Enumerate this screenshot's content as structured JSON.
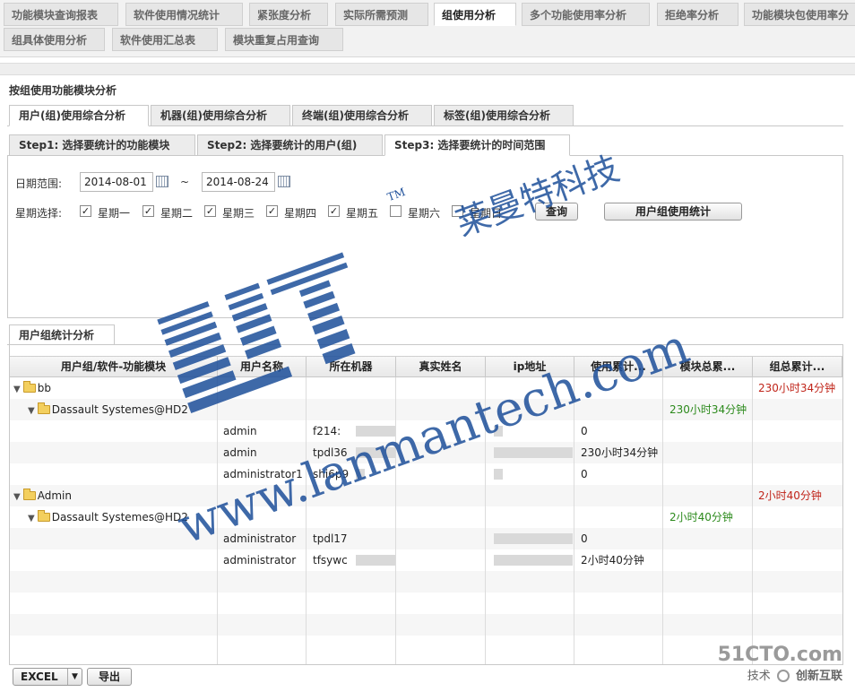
{
  "top_tabs": [
    {
      "label": "功能模块查询报表",
      "active": false
    },
    {
      "label": "软件使用情况统计",
      "active": false
    },
    {
      "label": "紧张度分析",
      "active": false
    },
    {
      "label": "实际所需预测",
      "active": false
    },
    {
      "label": "组使用分析",
      "active": true
    },
    {
      "label": "多个功能使用率分析",
      "active": false
    },
    {
      "label": "拒绝率分析",
      "active": false
    },
    {
      "label": "功能模块包使用率分",
      "active": false
    },
    {
      "label": "组具体使用分析",
      "active": false
    },
    {
      "label": "软件使用汇总表",
      "active": false
    },
    {
      "label": "模块重复占用查询",
      "active": false
    }
  ],
  "page_title": "按组使用功能模块分析",
  "analysis_tabs": [
    {
      "label": "用户(组)使用综合分析",
      "active": true
    },
    {
      "label": "机器(组)使用综合分析",
      "active": false
    },
    {
      "label": "终端(组)使用综合分析",
      "active": false
    },
    {
      "label": "标签(组)使用综合分析",
      "active": false
    }
  ],
  "step_tabs": [
    {
      "label": "Step1: 选择要统计的功能模块",
      "active": false
    },
    {
      "label": "Step2: 选择要统计的用户(组)",
      "active": false
    },
    {
      "label": "Step3: 选择要统计的时间范围",
      "active": true
    }
  ],
  "filters": {
    "date_range_label": "日期范围:",
    "date_from": "2014-08-01",
    "date_sep": "~",
    "date_to": "2014-08-24",
    "weekday_label": "星期选择:",
    "weekdays": [
      {
        "label": "星期一",
        "checked": true
      },
      {
        "label": "星期二",
        "checked": true
      },
      {
        "label": "星期三",
        "checked": true
      },
      {
        "label": "星期四",
        "checked": true
      },
      {
        "label": "星期五",
        "checked": true
      },
      {
        "label": "星期六",
        "checked": false
      },
      {
        "label": "星期日",
        "checked": false
      }
    ],
    "query_button": "查询",
    "stats_button": "用户组使用统计"
  },
  "result_tab": "用户组统计分析",
  "grid": {
    "columns": [
      "用户组/软件-功能模块",
      "用户名称",
      "所在机器",
      "真实姓名",
      "ip地址",
      "使用累计...",
      "模块总累...",
      "组总累计..."
    ],
    "rows": [
      {
        "tree": "bb",
        "level": 0,
        "user": "",
        "machine": "",
        "real_name": "",
        "ip": "",
        "usage": "",
        "module_total": "",
        "group_total": "230小时34分钟"
      },
      {
        "tree": "Dassault Systemes@HD2",
        "level": 1,
        "user": "",
        "machine": "",
        "real_name": "",
        "ip": "",
        "usage": "",
        "module_total": "230小时34分钟",
        "group_total": ""
      },
      {
        "tree": "",
        "level": 2,
        "user": "admin",
        "machine": "f214:",
        "real_name": "",
        "ip": "",
        "usage": "0",
        "module_total": "",
        "group_total": ""
      },
      {
        "tree": "",
        "level": 2,
        "user": "admin",
        "machine": "tpdl36",
        "real_name": "",
        "ip": "",
        "usage": "230小时34分钟",
        "module_total": "",
        "group_total": ""
      },
      {
        "tree": "",
        "level": 2,
        "user": "administrator1",
        "machine": "shi6p9",
        "real_name": "",
        "ip": "",
        "usage": "0",
        "module_total": "",
        "group_total": ""
      },
      {
        "tree": "Admin",
        "level": 0,
        "user": "",
        "machine": "",
        "real_name": "",
        "ip": "",
        "usage": "",
        "module_total": "",
        "group_total": "2小时40分钟"
      },
      {
        "tree": "Dassault Systemes@HD2",
        "level": 1,
        "user": "",
        "machine": "",
        "real_name": "",
        "ip": "",
        "usage": "",
        "module_total": "2小时40分钟",
        "group_total": ""
      },
      {
        "tree": "",
        "level": 2,
        "user": "administrator",
        "machine": "tpdl17",
        "real_name": "",
        "ip": "",
        "usage": "0",
        "module_total": "",
        "group_total": ""
      },
      {
        "tree": "",
        "level": 2,
        "user": "administrator",
        "machine": "tfsywc",
        "real_name": "",
        "ip": "",
        "usage": "2小时40分钟",
        "module_total": "",
        "group_total": ""
      }
    ]
  },
  "export": {
    "format": "EXCEL",
    "export_button": "导出"
  },
  "watermark": {
    "brand_cn": "莱曼特科技",
    "brand_tm": "TM",
    "url": "www.lanmantech.com",
    "color": "#1d4f9a"
  },
  "corner_watermark": {
    "site": "51CTO.com",
    "sub": "技术",
    "logo_text": "创新互联"
  }
}
